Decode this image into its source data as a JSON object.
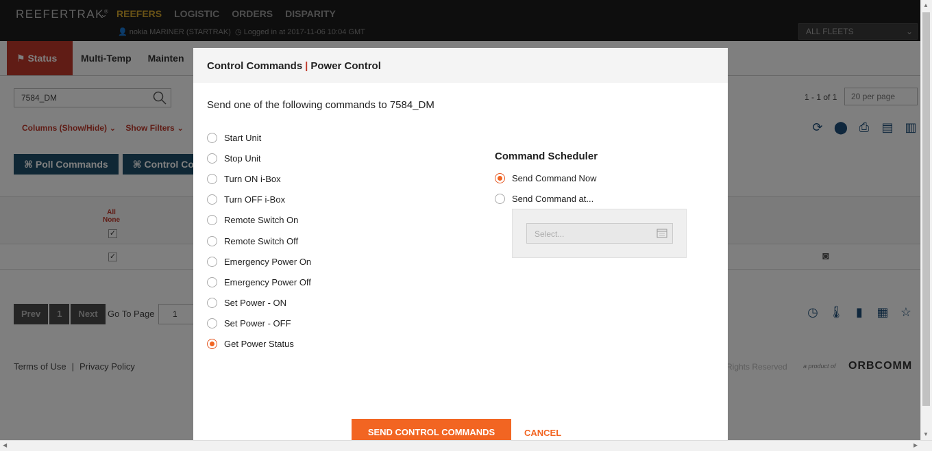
{
  "app": {
    "brand": "REEFERTRAK",
    "brand_mark": "®",
    "nav": [
      "REEFERS",
      "LOGISTIC",
      "ORDERS",
      "DISPARITY"
    ],
    "user_line": "nokia MARINER (STARTRAK)",
    "login_line": "Logged in at 2017-11-06 10:04 GMT",
    "fleet_select": "ALL FLEETS"
  },
  "tabs": [
    "Status",
    "Multi-Temp",
    "Mainten"
  ],
  "search": {
    "value": "7584_DM"
  },
  "pagination": {
    "info": "1 - 1 of 1",
    "per_page": "20 per page",
    "prev": "Prev",
    "page": "1",
    "next": "Next",
    "goto_label": "Go To Page",
    "goto_value": "1"
  },
  "filters": {
    "columns": "Columns (Show/Hide)",
    "show_filters": "Show Filters"
  },
  "actions": {
    "poll": "⌘ Poll Commands",
    "control": "⌘ Control Com"
  },
  "table": {
    "all": "All",
    "none": "None"
  },
  "footer": {
    "terms": "Terms of Use",
    "privacy": "Privacy Policy",
    "rights": "Rights Reserved",
    "a_product_of": "a product of",
    "company": "ORBCOMM"
  },
  "modal": {
    "title_left": "Control Commands",
    "title_sep": "|",
    "title_right": "Power Control",
    "intro": "Send one of the following commands to 7584_DM",
    "commands": [
      {
        "label": "Start Unit",
        "selected": false
      },
      {
        "label": "Stop Unit",
        "selected": false
      },
      {
        "label": "Turn ON i-Box",
        "selected": false
      },
      {
        "label": "Turn OFF i-Box",
        "selected": false
      },
      {
        "label": "Remote Switch On",
        "selected": false
      },
      {
        "label": "Remote Switch Off",
        "selected": false
      },
      {
        "label": "Emergency Power On",
        "selected": false
      },
      {
        "label": "Emergency Power Off",
        "selected": false
      },
      {
        "label": "Set Power - ON",
        "selected": false
      },
      {
        "label": "Set Power - OFF",
        "selected": false
      },
      {
        "label": "Get Power Status",
        "selected": true
      }
    ],
    "scheduler": {
      "title": "Command Scheduler",
      "now": "Send Command Now",
      "at": "Send Command at...",
      "selected": "now",
      "date_placeholder": "Select..."
    },
    "send_button": "SEND CONTROL COMMANDS",
    "cancel_button": "CANCEL"
  },
  "colors": {
    "accent": "#f26522",
    "brand_red": "#c0392b",
    "nav_active": "#d4a72c",
    "button_dark": "#1e4f6a"
  }
}
